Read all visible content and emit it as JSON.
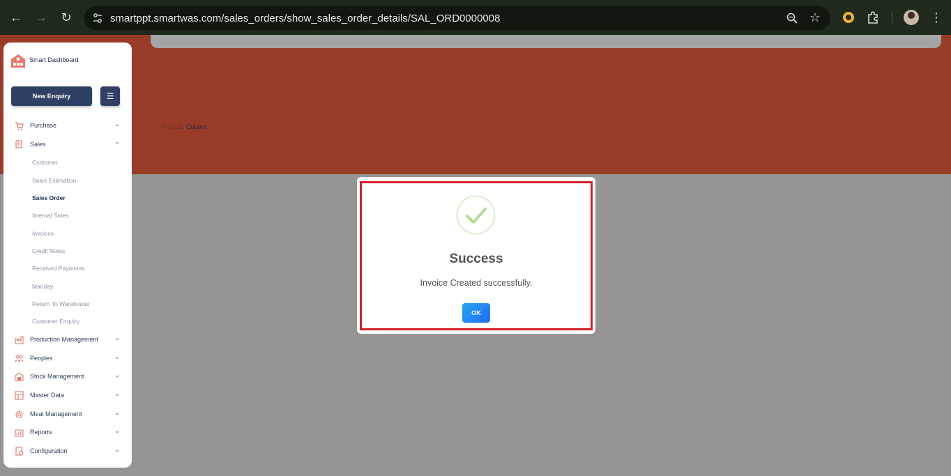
{
  "browser": {
    "url": "smartppt.smartwas.com/sales_orders/show_sales_order_details/SAL_ORD0000008"
  },
  "footer": {
    "prefix": "© 2026, ",
    "brand": "Cupent"
  },
  "sidebar": {
    "logo_text": "Smart Dashboard",
    "new_enquiry_label": "New Enquiry",
    "menu": [
      {
        "label": "Purchase",
        "icon": "cart-icon",
        "expanded": false
      },
      {
        "label": "Sales",
        "icon": "sales-icon",
        "expanded": true
      },
      {
        "label": "Production Management",
        "icon": "production-icon",
        "expanded": false
      },
      {
        "label": "Peoples",
        "icon": "people-icon",
        "expanded": false
      },
      {
        "label": "Stock Management",
        "icon": "stock-icon",
        "expanded": false
      },
      {
        "label": "Master Data",
        "icon": "master-data-icon",
        "expanded": false
      },
      {
        "label": "Meal Management",
        "icon": "meal-icon",
        "expanded": false
      },
      {
        "label": "Reports",
        "icon": "reports-icon",
        "expanded": false
      },
      {
        "label": "Configuration",
        "icon": "configuration-icon",
        "expanded": false
      }
    ],
    "sales_sub": [
      "Customer",
      "Sales Estimation",
      "Sales Order",
      "Internal Sales",
      "Invoices",
      "Credit Notes",
      "Received Payments",
      "Manday",
      "Return To Warehouse",
      "Customer Enquiry"
    ],
    "active_sub": "Sales Order"
  },
  "modal": {
    "title": "Success",
    "message": "Invoice Created successfully.",
    "ok_label": "OK"
  },
  "colors": {
    "header_bg": "#983b28",
    "overlay": "#959595",
    "primary": "#304064",
    "accent_icon": "#e8766a",
    "success": "#a5dc86",
    "highlight_border": "#d2202a"
  }
}
